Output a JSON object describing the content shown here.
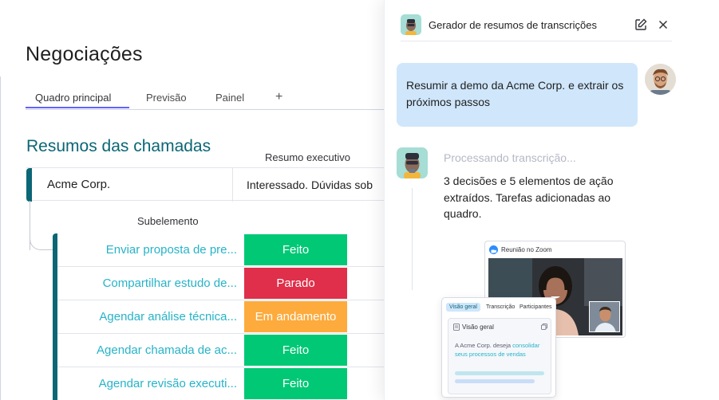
{
  "board": {
    "title": "Negociações",
    "tabs": [
      "Quadro principal",
      "Previsão",
      "Painel"
    ],
    "add_tab": "+",
    "group_title": "Resumos das chamadas",
    "column_summary": "Resumo executivo",
    "main_item": {
      "name": "Acme Corp.",
      "summary": "Interessado. Dúvidas sob"
    },
    "subitem_header": "Subelemento",
    "subitems": [
      {
        "name": "Enviar proposta de pre...",
        "status": "Feito"
      },
      {
        "name": "Compartilhar estudo de...",
        "status": "Parado"
      },
      {
        "name": "Agendar análise técnica...",
        "status": "Em andamento"
      },
      {
        "name": "Agendar chamada de ac...",
        "status": "Feito"
      },
      {
        "name": "Agendar revisão executi...",
        "status": "Feito"
      }
    ]
  },
  "colors": {
    "feito": "#00c875",
    "parado": "#df2f4a",
    "em_andamento": "#fdab3d",
    "accent": "#6161ff",
    "group": "#0b6675"
  },
  "panel": {
    "title": "Gerador de resumos de transcrições",
    "user_message": "Resumir a demo da Acme Corp. e extrair os próximos passos",
    "processing": "Processando transcrição...",
    "bot_message": "3 decisões e 5 elementos de ação extraídos. Tarefas adicionadas ao quadro.",
    "zoom_card": {
      "label": "Reunião no Zoom"
    },
    "summary_card": {
      "tabs": [
        "Visão geral",
        "Transcrição",
        "Participantes"
      ],
      "inner_title": "Visão geral",
      "text_plain": "A Acme Corp. deseja ",
      "text_highlight": "consolidar seus processos de vendas"
    }
  }
}
